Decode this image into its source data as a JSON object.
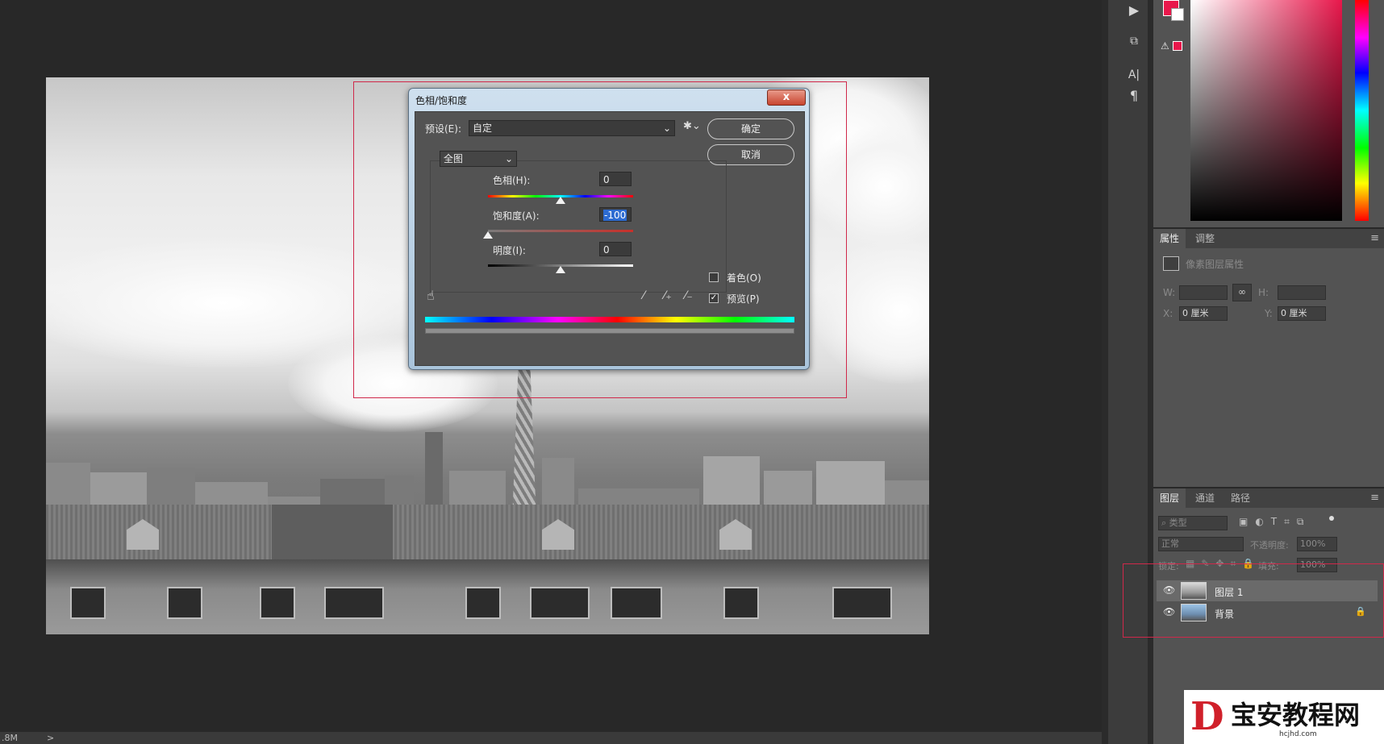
{
  "dialog": {
    "title": "色相/饱和度",
    "close_label": "x",
    "preset_label": "预设(E):",
    "preset_value": "自定",
    "channel_value": "全图",
    "hue_label": "色相(H):",
    "hue_value": "0",
    "saturation_label": "饱和度(A):",
    "saturation_value": "-100",
    "lightness_label": "明度(I):",
    "lightness_value": "0",
    "ok_label": "确定",
    "cancel_label": "取消",
    "colorize_label": "着色(O)",
    "colorize_checked": false,
    "preview_label": "预览(P)",
    "preview_checked": true
  },
  "properties_panel": {
    "tabs": [
      "属性",
      "调整"
    ],
    "heading": "像素图层属性",
    "w_label": "W:",
    "h_label": "H:",
    "x_label": "X:",
    "x_value": "0 厘米",
    "y_label": "Y:",
    "y_value": "0 厘米"
  },
  "layers_panel": {
    "tabs": [
      "图层",
      "通道",
      "路径"
    ],
    "filter_kind": "类型",
    "blend_mode": "正常",
    "opacity_label": "不透明度:",
    "opacity_value": "100%",
    "lock_label": "锁定:",
    "fill_label": "填充:",
    "fill_value": "100%",
    "layers": [
      {
        "name": "图层 1",
        "selected": true
      },
      {
        "name": "背景",
        "selected": false,
        "locked": true
      }
    ]
  },
  "status_bar": {
    "doc_size": ".8M",
    "arrow": ">"
  },
  "watermark": {
    "text": "宝安教程网",
    "url": "hcjhd.com"
  },
  "colors": {
    "foreground": "#e8174b",
    "accent_red": "#d0284a"
  }
}
